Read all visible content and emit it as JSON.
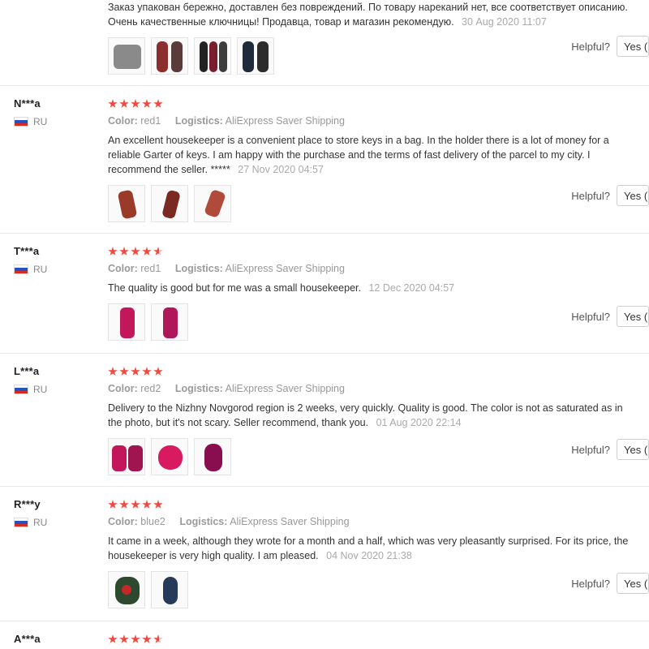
{
  "reviews": [
    {
      "user": "",
      "country": "",
      "stars": 0,
      "color": "",
      "logistics": "",
      "text": "Заказ упакован бережно, доставлен без повреждений. По товару нареканий нет, все соответствует описанию. Очень качественные ключницы! Продавца, товар и магазин рекомендую.",
      "date": "30 Aug 2020 11:07",
      "helpful_label": "Helpful?",
      "yes_label": "Yes ("
    },
    {
      "user": "N***a",
      "country": "RU",
      "stars": 5,
      "color_key": "Color:",
      "color": "red1",
      "logistics_key": "Logistics:",
      "logistics": "AliExpress Saver Shipping",
      "text": "An excellent housekeeper is a convenient place to store keys in a bag. In the holder there is a lot of money for a reliable Garter of keys. I am happy with the purchase and the terms of fast delivery of the parcel to my city. I recommend the seller. *****",
      "date": "27 Nov 2020 04:57",
      "helpful_label": "Helpful?",
      "yes_label": "Yes ("
    },
    {
      "user": "T***a",
      "country": "RU",
      "stars": 4.5,
      "color_key": "Color:",
      "color": "red1",
      "logistics_key": "Logistics:",
      "logistics": "AliExpress Saver Shipping",
      "text": "The quality is good but for me was a small housekeeper.",
      "date": "12 Dec 2020 04:57",
      "helpful_label": "Helpful?",
      "yes_label": "Yes ("
    },
    {
      "user": "L***a",
      "country": "RU",
      "stars": 5,
      "color_key": "Color:",
      "color": "red2",
      "logistics_key": "Logistics:",
      "logistics": "AliExpress Saver Shipping",
      "text": "Delivery to the Nizhny Novgorod region is 2 weeks, very quickly. Quality is good. The color is not as saturated as in the photo, but it's not scary. Seller recommend, thank you.",
      "date": "01 Aug 2020 22:14",
      "helpful_label": "Helpful?",
      "yes_label": "Yes ("
    },
    {
      "user": "R***y",
      "country": "RU",
      "stars": 5,
      "color_key": "Color:",
      "color": "blue2",
      "logistics_key": "Logistics:",
      "logistics": "AliExpress Saver Shipping",
      "text": "It came in a week, although they wrote for a month and a half, which was very pleasantly surprised. For its price, the housekeeper is very high quality. I am pleased.",
      "date": "04 Nov 2020 21:38",
      "helpful_label": "Helpful?",
      "yes_label": "Yes ("
    },
    {
      "user": "A***a",
      "country": "",
      "stars": 4.5,
      "color": "",
      "logistics": "",
      "text": "",
      "date": ""
    }
  ],
  "colors": {
    "star": "#f04a40",
    "divider": "#e8e8e8",
    "muted_text": "#999999"
  }
}
